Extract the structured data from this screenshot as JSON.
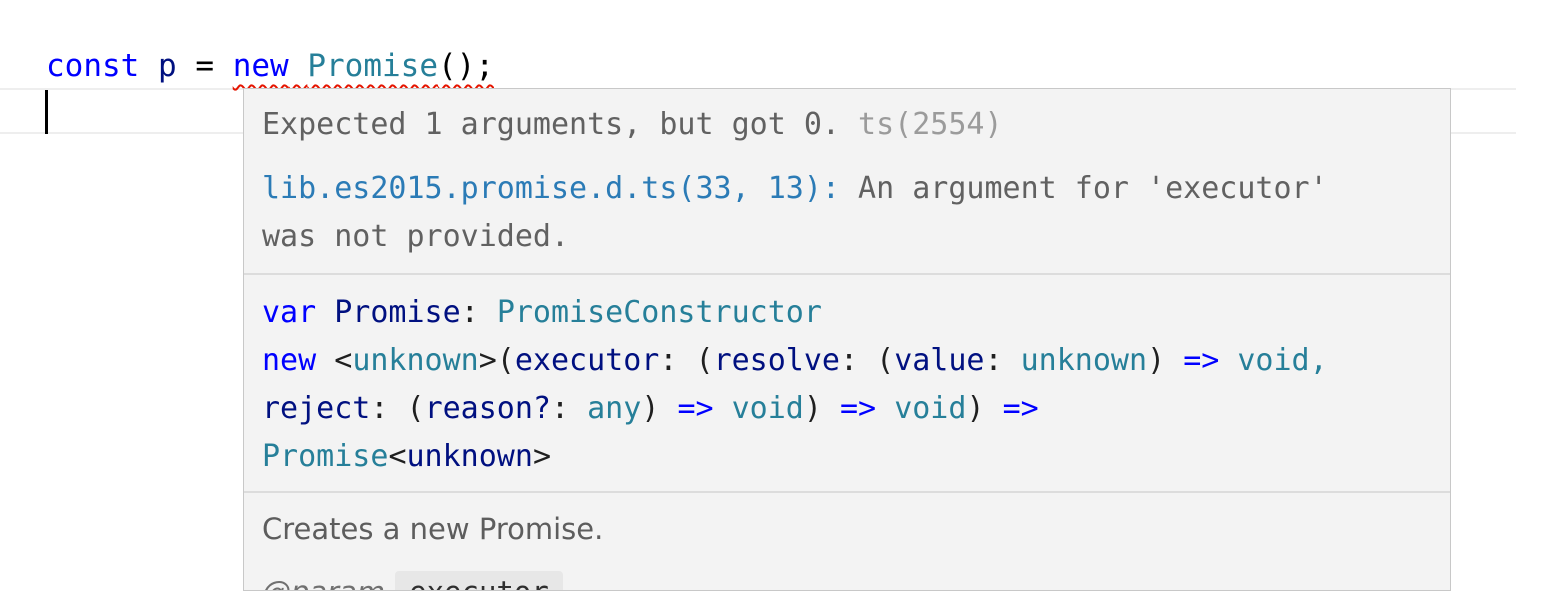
{
  "editor": {
    "tokens": {
      "kw_const": "const",
      "var_p": "p",
      "op_eq": "=",
      "kw_new": "new",
      "type_promise": "Promise",
      "punct": "();"
    }
  },
  "hover": {
    "diagnostic": {
      "message": "Expected 1 arguments, but got 0.",
      "code": "ts(2554)",
      "related_location": "lib.es2015.promise.d.ts(33, 13)",
      "related_separator": ":",
      "related_message_line1": "An argument for 'executor'",
      "related_message_line2": "was not provided."
    },
    "signature": {
      "line1": {
        "kw": "var",
        "name": "Promise",
        "colon": ":",
        "type": "PromiseConstructor"
      },
      "line2": {
        "kw_new": "new",
        "lt": "<",
        "generic": "unknown",
        "gt_paren": ">(",
        "p_executor": "executor",
        "colon_paren": ": (",
        "p_resolve": "resolve",
        "colon_paren2": ": (",
        "p_value": "value",
        "colon": ":",
        "t_unknown": "unknown",
        "paren_close": ")",
        "arrow": "=>",
        "t_void": "void,"
      },
      "line3": {
        "p_reject": "reject",
        "colon_paren": ": (",
        "p_reason": "reason?",
        "colon": ":",
        "t_any": "any",
        "paren_close": ")",
        "arrow1": "=>",
        "t_void1": "void",
        "paren_close2": ")",
        "arrow2": "=>",
        "t_void2": "void",
        "paren_close3": ")",
        "arrow3": "=>"
      },
      "line4": {
        "t_promise": "Promise",
        "lt": "<",
        "generic": "unknown",
        "gt": ">"
      }
    },
    "doc": {
      "description": "Creates a new Promise.",
      "param_tag": "@param",
      "param_name": "executor"
    }
  }
}
